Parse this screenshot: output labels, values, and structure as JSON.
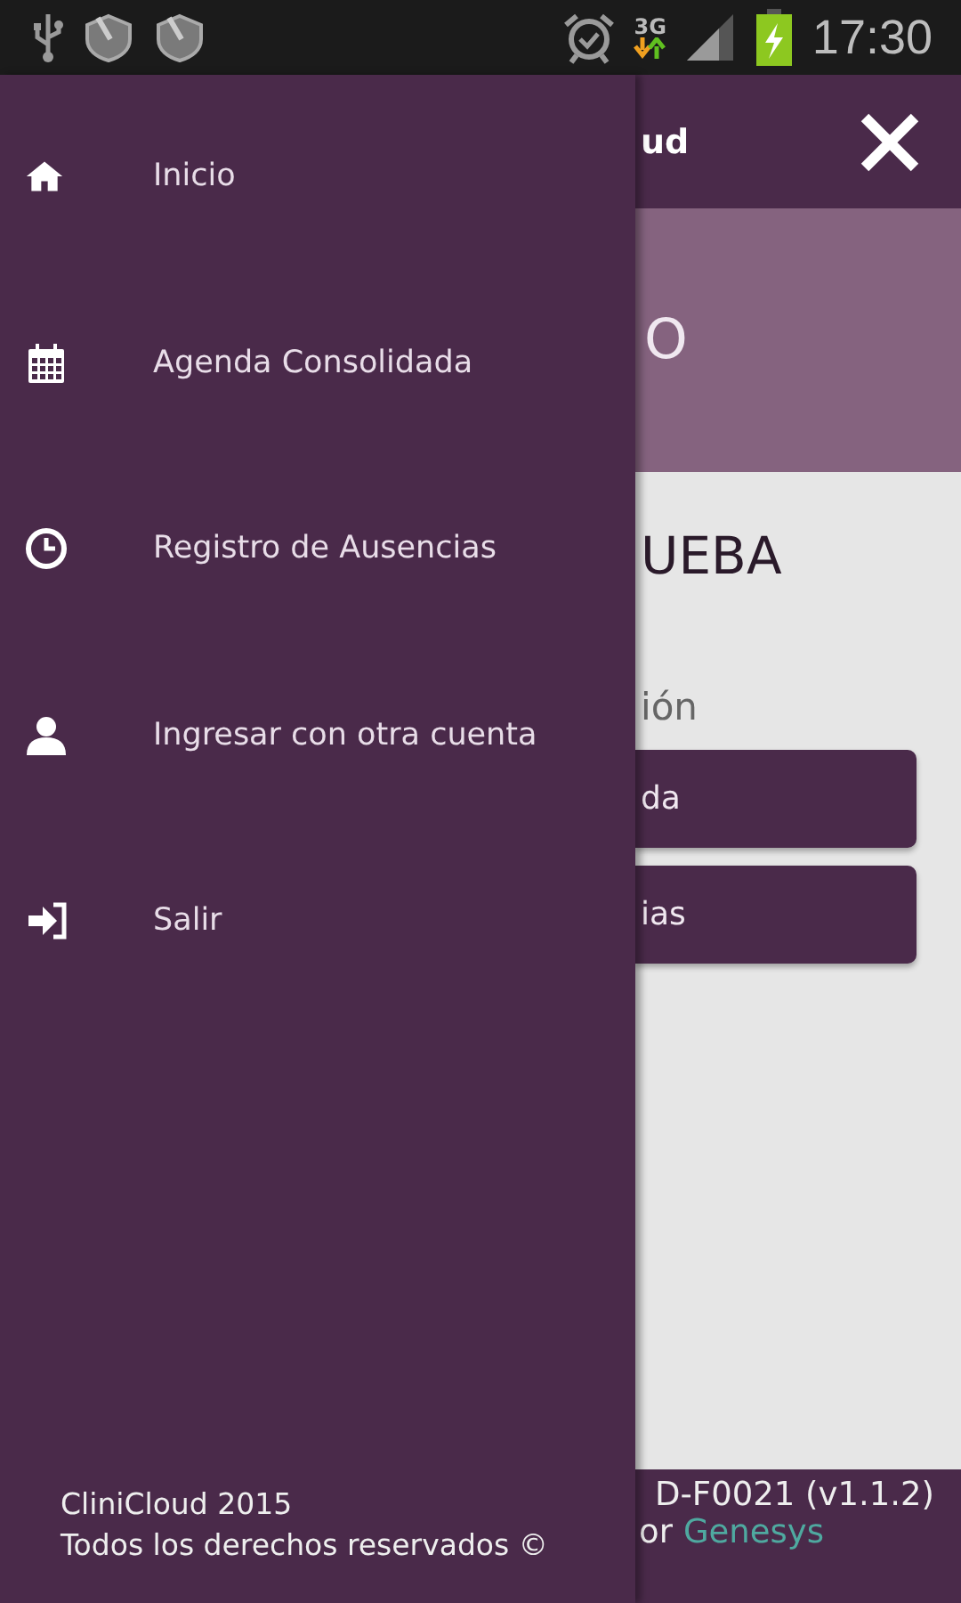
{
  "status_bar": {
    "network": "3G",
    "time": "17:30"
  },
  "drawer": {
    "items": [
      {
        "kind": "home",
        "label": "Inicio"
      },
      {
        "kind": "calendar",
        "label": "Agenda Consolidada"
      },
      {
        "kind": "clock",
        "label": "Registro de Ausencias"
      },
      {
        "kind": "user",
        "label": "Ingresar con otra cuenta"
      },
      {
        "kind": "signin",
        "label": "Salir"
      }
    ],
    "footer": [
      "CliniCloud 2015",
      "Todos los derechos reservados ©"
    ]
  },
  "page": {
    "header_title": "ud",
    "banner_text": "O",
    "heading": "UEBA",
    "section_label": "ión",
    "buttons": [
      "da",
      "ias"
    ],
    "footer": {
      "version": "D-F0021 (v1.1.2)",
      "credit_prefix": "or",
      "credit_link": "Genesys"
    }
  }
}
